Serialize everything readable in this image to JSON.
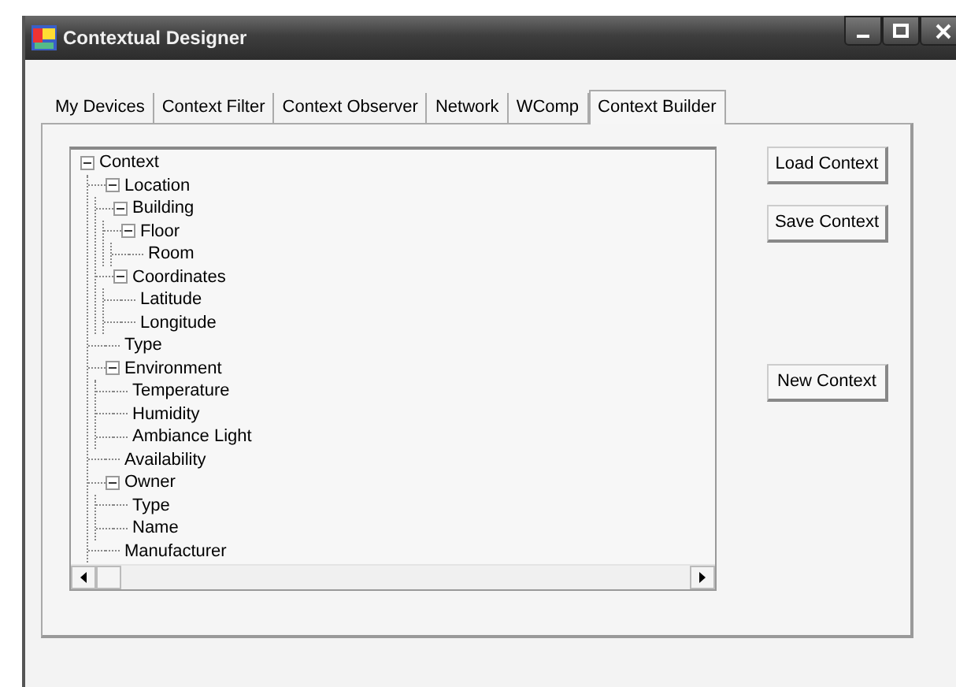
{
  "window": {
    "title": "Contextual Designer"
  },
  "tabs": [
    {
      "label": "My Devices",
      "selected": false
    },
    {
      "label": "Context Filter",
      "selected": false
    },
    {
      "label": "Context Observer",
      "selected": false
    },
    {
      "label": "Network",
      "selected": false
    },
    {
      "label": "WComp",
      "selected": false
    },
    {
      "label": "Context Builder",
      "selected": true
    }
  ],
  "tree": [
    {
      "label": "Context",
      "expanded": true,
      "children": [
        {
          "label": "Location",
          "expanded": true,
          "children": [
            {
              "label": "Building",
              "expanded": true,
              "children": [
                {
                  "label": "Floor",
                  "expanded": true,
                  "children": [
                    {
                      "label": "Room"
                    }
                  ]
                }
              ]
            },
            {
              "label": "Coordinates",
              "expanded": true,
              "children": [
                {
                  "label": "Latitude"
                },
                {
                  "label": "Longitude"
                }
              ]
            }
          ]
        },
        {
          "label": "Type"
        },
        {
          "label": "Environment",
          "expanded": true,
          "children": [
            {
              "label": "Temperature"
            },
            {
              "label": "Humidity"
            },
            {
              "label": "Ambiance Light"
            }
          ]
        },
        {
          "label": "Availability"
        },
        {
          "label": "Owner",
          "expanded": true,
          "children": [
            {
              "label": "Type"
            },
            {
              "label": "Name"
            }
          ]
        },
        {
          "label": "Manufacturer"
        }
      ]
    }
  ],
  "buttons": [
    {
      "label": "Load Context"
    },
    {
      "label": "Save Context"
    },
    {
      "label": "New Context"
    }
  ]
}
